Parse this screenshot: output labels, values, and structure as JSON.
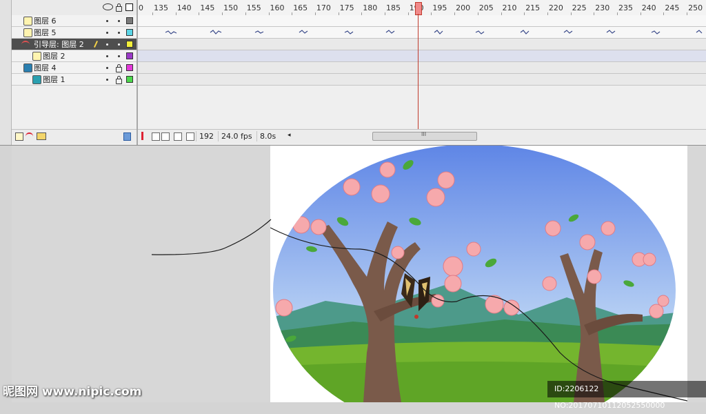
{
  "timeline": {
    "ruler_ticks": [
      "0",
      "135",
      "140",
      "145",
      "150",
      "155",
      "160",
      "165",
      "170",
      "175",
      "180",
      "185",
      "190",
      "195",
      "200",
      "205",
      "210",
      "215",
      "220",
      "225",
      "230",
      "235",
      "240",
      "245",
      "250"
    ],
    "layers": [
      {
        "name": "图层 6",
        "color": "#7a7a7a",
        "type": "normal",
        "locked": false,
        "selected": false
      },
      {
        "name": "图层 5",
        "color": "#5ad5e6",
        "type": "normal",
        "locked": false,
        "selected": false
      },
      {
        "name": "引导层: 图层 2",
        "color": "#f2ee3a",
        "type": "guide",
        "locked": false,
        "selected": true
      },
      {
        "name": "图层 2",
        "color": "#9b3ac8",
        "type": "guided",
        "locked": false,
        "selected": false
      },
      {
        "name": "图层 4",
        "color": "#e339d8",
        "type": "mask",
        "locked": true,
        "selected": false
      },
      {
        "name": "图层 1",
        "color": "#4cd84c",
        "type": "masked",
        "locked": true,
        "selected": false
      }
    ],
    "current_frame": "192",
    "fps": "24.0 fps",
    "elapsed": "8.0s",
    "scroll_label": "III"
  },
  "watermark": {
    "left": "昵图网 www.nipic.com",
    "right": "ID:2206122 NO:20170710112052550000"
  },
  "colors": {
    "accent": "#c0392b",
    "sky_top": "#6a8fe8",
    "sky_bottom": "#c8dcf5",
    "grass": "#6aae2c",
    "trunk": "#7a5a4a",
    "blossom": "#f6a9ac"
  }
}
